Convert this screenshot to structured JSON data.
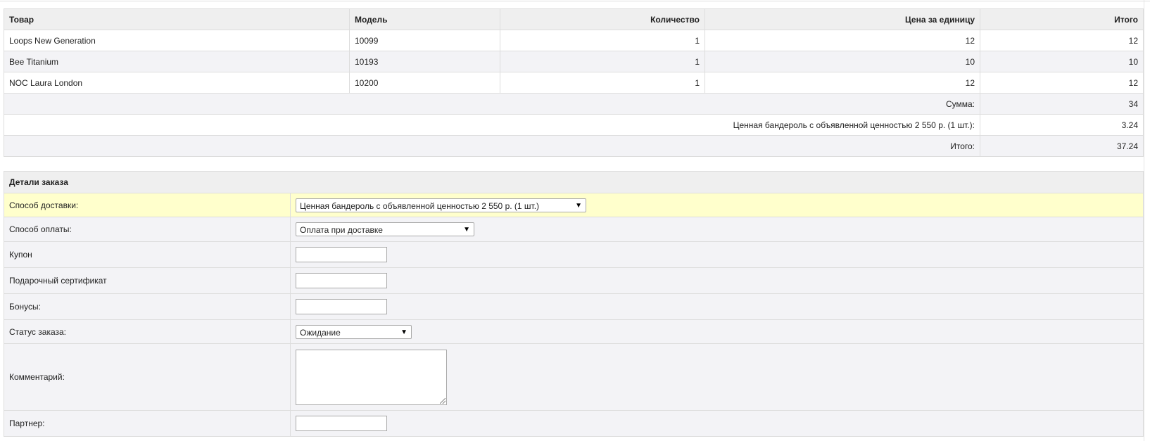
{
  "products": {
    "headers": [
      "Товар",
      "Модель",
      "Количество",
      "Цена за единицу",
      "Итого"
    ],
    "rows": [
      {
        "name": "Loops New Generation",
        "model": "10099",
        "qty": "1",
        "price": "12",
        "total": "12"
      },
      {
        "name": "Bee Titanium",
        "model": "10193",
        "qty": "1",
        "price": "10",
        "total": "10"
      },
      {
        "name": "NOC Laura London",
        "model": "10200",
        "qty": "1",
        "price": "12",
        "total": "12"
      }
    ],
    "totals": [
      {
        "label": "Сумма:",
        "value": "34"
      },
      {
        "label": "Ценная бандероль с объявленной ценностью 2 550 р. (1 шт.):",
        "value": "3.24"
      },
      {
        "label": "Итого:",
        "value": "37.24"
      }
    ]
  },
  "details": {
    "title": "Детали заказа",
    "shipping_label": "Способ доставки:",
    "shipping_value": "Ценная бандероль с объявленной ценностью 2 550 р. (1 шт.)",
    "payment_label": "Способ оплаты:",
    "payment_value": "Оплата при доставке",
    "coupon_label": "Купон",
    "coupon_value": "",
    "voucher_label": "Подарочный сертификат",
    "voucher_value": "",
    "bonus_label": "Бонусы:",
    "bonus_value": "",
    "status_label": "Статус заказа:",
    "status_value": "Ожидание",
    "comment_label": "Комментарий:",
    "comment_value": "",
    "partner_label": "Партнер:",
    "partner_value": ""
  },
  "icons": {
    "dropdown_arrow": "▼"
  }
}
